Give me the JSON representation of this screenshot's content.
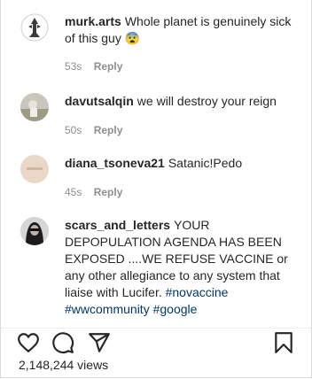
{
  "comments": [
    {
      "username": "murk.arts",
      "text": "Whole planet is genuinely sick of this guy",
      "emoji": "😨",
      "time": "53s",
      "reply_label": "Reply"
    },
    {
      "username": "davutsalqin",
      "text": "we will destroy your reign",
      "time": "50s",
      "reply_label": "Reply"
    },
    {
      "username": "diana_tsoneva21",
      "text": "Satanic!Pedo",
      "time": "45s",
      "reply_label": "Reply"
    },
    {
      "username": "scars_and_letters",
      "text": "YOUR DEPOPULATION AGENDA HAS BEEN EXPOSED ....WE REFUSE VACCINE or any other allegiance to any system that liaise with Lucifer.",
      "hashtags": [
        "#novaccine",
        "#wwcommunity",
        "#google"
      ],
      "time": "",
      "reply_label": ""
    }
  ],
  "actions": {
    "like_icon": "heart-icon",
    "comment_icon": "comment-bubble-icon",
    "share_icon": "paper-plane-icon",
    "save_icon": "bookmark-icon"
  },
  "views": "2,148,244 views"
}
